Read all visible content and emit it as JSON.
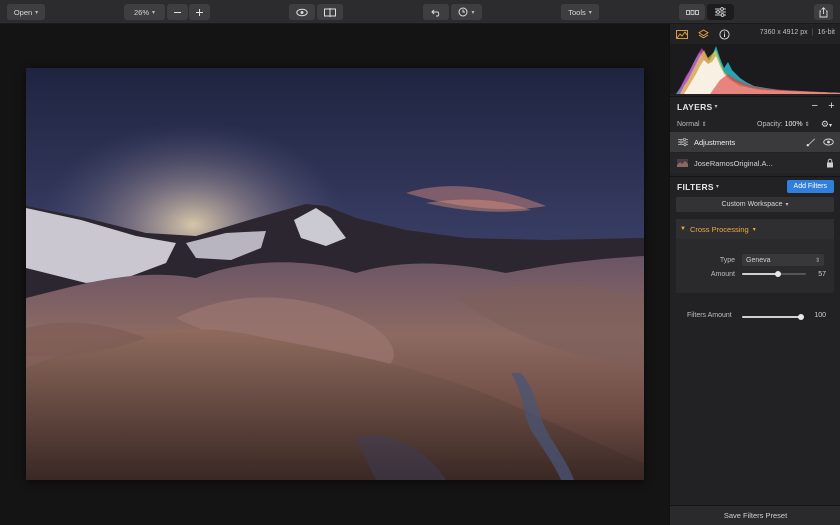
{
  "toolbar": {
    "open_label": "Open",
    "zoom_value": "26%",
    "zoom_out_icon": "minus-icon",
    "zoom_in_icon": "plus-icon",
    "preview_icon": "eye-icon",
    "compare_icon": "split-view-icon",
    "undo_icon": "undo-icon",
    "history_icon": "clock-icon",
    "tools_label": "Tools",
    "layout_icon": "panels-icon",
    "adjust_icon": "sliders-icon",
    "share_icon": "share-icon"
  },
  "panel": {
    "tabs": [
      "histogram-icon",
      "layers-icon",
      "info-icon"
    ],
    "image_size": "7360 x 4912 px",
    "bit_depth": "16-bit",
    "layers": {
      "title": "LAYERS",
      "remove_symbol": "−",
      "add_symbol": "+",
      "blend_mode": "Normal",
      "opacity_label": "Opacity:",
      "opacity_value": "100%",
      "items": [
        {
          "name": "Adjustments",
          "icon": "adjustments-icon"
        },
        {
          "name": "JoseRamosOriginal.A...",
          "icon": "image-thumbnail-icon"
        }
      ]
    },
    "filters": {
      "title": "FILTERS",
      "add_button": "Add Filters",
      "workspace": "Custom Workspace",
      "cards": [
        {
          "name": "Cross Processing",
          "type_label": "Type",
          "type_value": "Geneva",
          "amount_label": "Amount",
          "amount_value": "57",
          "amount_fraction": 0.57
        }
      ],
      "filters_amount_label": "Filters Amount",
      "filters_amount_value": "100",
      "filters_amount_fraction": 1.0
    },
    "save_preset": "Save Filters Preset"
  },
  "colors": {
    "accent_blue": "#2f7fdc",
    "filter_orange": "#f0a83a",
    "panel_bg": "#222224",
    "toolbar_bg": "#2c2c2e"
  }
}
